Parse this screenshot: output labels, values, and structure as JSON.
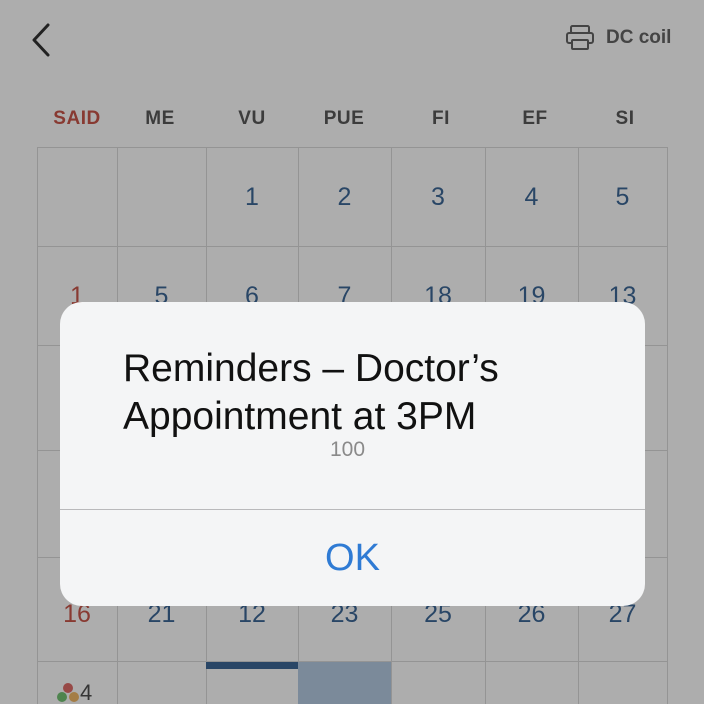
{
  "header": {
    "back_icon": "chevron-left-icon",
    "action_icon": "printer-icon",
    "action_label": "DC coil"
  },
  "weekdays": [
    "SAID",
    "ME",
    "VU",
    "PUE",
    "FI",
    "EF",
    "SI"
  ],
  "calendar": {
    "rows": [
      [
        "",
        "",
        "1",
        "2",
        "3",
        "4",
        "5"
      ],
      [
        "1",
        "5",
        "6",
        "7",
        "18",
        "19",
        "13"
      ],
      [
        "16",
        "21",
        "12",
        "23",
        "25",
        "26",
        "27"
      ]
    ],
    "last_row_event_count": "4"
  },
  "alert": {
    "title": "Reminders – Doctor’s Appointment at 3PM",
    "message": "100",
    "ok_label": "OK"
  },
  "colors": {
    "sunday_red": "#c0392b",
    "date_blue": "#1d4f86",
    "button_blue": "#2f7bd4",
    "alert_bg": "#f4f5f6"
  }
}
